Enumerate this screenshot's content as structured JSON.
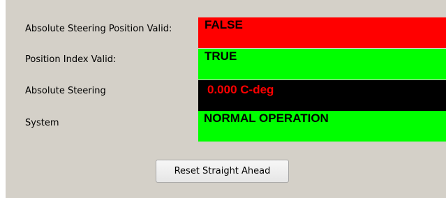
{
  "rows": [
    {
      "label": "Absolute Steering Position Valid:",
      "value": "FALSE",
      "background": "#ff0000",
      "text_color": "#000000"
    },
    {
      "label": "Position Index Valid:",
      "value": "TRUE",
      "background": "#00ff00",
      "text_color": "#000000"
    },
    {
      "label": "Absolute Steering",
      "value": "0.000 C-deg",
      "background": "#000000",
      "text_color": "#ff0000"
    },
    {
      "label": "System",
      "value": "NORMAL OPERATION",
      "background": "#00ff00",
      "text_color": "#000000"
    }
  ],
  "reset_button": {
    "label": "Reset Straight Ahead"
  }
}
